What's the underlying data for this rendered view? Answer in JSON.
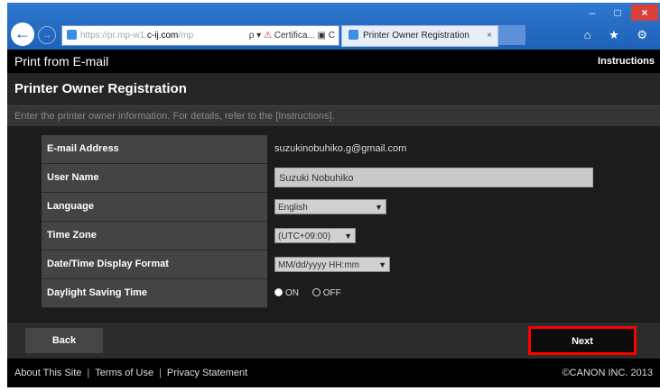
{
  "browser": {
    "window_controls": {
      "minimize": "–",
      "maximize": "□",
      "close": "×"
    },
    "back_icon": "←",
    "forward_icon": "→",
    "address": {
      "prefix": "https://pr.mp-w1.",
      "domain": "c-ij.com",
      "suffix": "/mp",
      "search_glyph": "ρ ▾",
      "cert_label": "Certifica...",
      "lock_glyph": "🔒",
      "refresh_glyph": "C"
    },
    "tab": {
      "title": "Printer Owner Registration",
      "close": "×"
    },
    "right_icons": "⌂ ★ ⚙"
  },
  "header": {
    "title": "Print from E-mail",
    "instructions_link": "Instructions"
  },
  "page": {
    "heading": "Printer Owner Registration",
    "hint": "Enter the printer owner information. For details, refer to the [Instructions]."
  },
  "form": {
    "email": {
      "label": "E-mail Address",
      "value": "suzukinobuhiko.g@gmail.com"
    },
    "user_name": {
      "label": "User Name",
      "value": "Suzuki Nobuhiko"
    },
    "language": {
      "label": "Language",
      "value": "English"
    },
    "time_zone": {
      "label": "Time Zone",
      "value": "(UTC+09:00)"
    },
    "date_format": {
      "label": "Date/Time Display Format",
      "value": "MM/dd/yyyy HH:mm"
    },
    "dst": {
      "label": "Daylight Saving Time",
      "on_label": "ON",
      "off_label": "OFF",
      "selected": "ON"
    }
  },
  "buttons": {
    "back": "Back",
    "next": "Next"
  },
  "footer": {
    "links": [
      "About This Site",
      "Terms of Use",
      "Privacy Statement"
    ],
    "separator": "|",
    "copyright": "©CANON INC. 2013"
  },
  "colors": {
    "highlight": "#ff0000",
    "browser_blue": "#1e62b8"
  }
}
